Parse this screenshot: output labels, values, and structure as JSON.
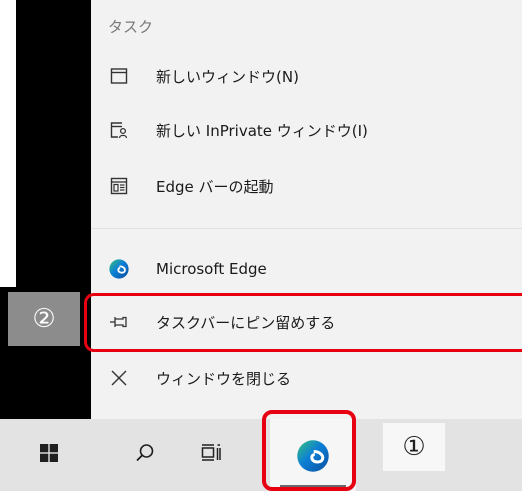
{
  "jumplist": {
    "section_header": "タスク",
    "tasks": [
      {
        "label": "新しいウィンドウ(N)",
        "icon": "window-icon"
      },
      {
        "label": "新しい InPrivate ウィンドウ(I)",
        "icon": "inprivate-window-icon"
      },
      {
        "label": "Edge バーの起動",
        "icon": "edge-bar-icon"
      }
    ],
    "app_item": {
      "label": "Microsoft Edge",
      "icon": "edge-logo-icon"
    },
    "pin_item": {
      "label": "タスクバーにピン留めする",
      "icon": "pin-icon"
    },
    "close_item": {
      "label": "ウィンドウを閉じる",
      "icon": "close-icon"
    }
  },
  "annotations": {
    "step_2": "②",
    "step_1": "①",
    "highlight_color": "#e60012"
  },
  "taskbar": {
    "buttons": [
      {
        "name": "start",
        "icon": "windows-logo-icon"
      },
      {
        "name": "search",
        "icon": "search-icon"
      },
      {
        "name": "task-view",
        "icon": "task-view-icon"
      },
      {
        "name": "edge",
        "icon": "edge-logo-icon",
        "active": true
      }
    ]
  },
  "colors": {
    "edge_blue": "#0c7fd6",
    "edge_green": "#37c27a",
    "edge_dark": "#0a4f9e"
  }
}
